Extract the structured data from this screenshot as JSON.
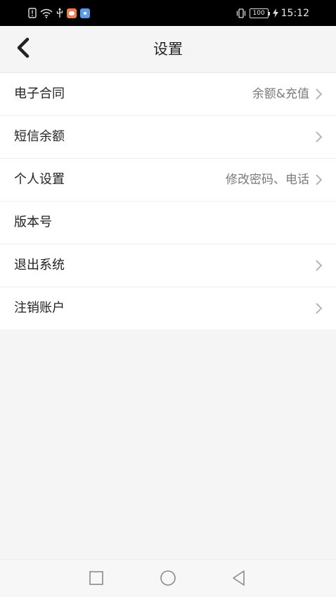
{
  "status_bar": {
    "time": "15:12",
    "battery": "100",
    "left_icons": [
      "sim-alert-icon",
      "wifi-icon",
      "usb-icon",
      "message-app-icon",
      "browser-app-icon"
    ],
    "right_icons": [
      "vibrate-icon",
      "battery-icon",
      "charging-icon"
    ]
  },
  "header": {
    "title": "设置",
    "back_icon": "chevron-left-icon"
  },
  "menu": {
    "items": [
      {
        "label": "电子合同",
        "value": "余额&充值",
        "has_chevron": true
      },
      {
        "label": "短信余额",
        "value": "",
        "has_chevron": true
      },
      {
        "label": "个人设置",
        "value": "修改密码、电话",
        "has_chevron": true
      },
      {
        "label": "版本号",
        "value": "",
        "has_chevron": false
      },
      {
        "label": "退出系统",
        "value": "",
        "has_chevron": true
      },
      {
        "label": "注销账户",
        "value": "",
        "has_chevron": true
      }
    ]
  },
  "nav_bar": {
    "buttons": [
      "recent-apps-icon",
      "home-icon",
      "back-triangle-icon"
    ]
  },
  "colors": {
    "background": "#f5f5f5",
    "list_background": "#ffffff",
    "status_bar": "#000000",
    "secondary_text": "#7a7a7a",
    "chevron": "#b5b5b5"
  }
}
